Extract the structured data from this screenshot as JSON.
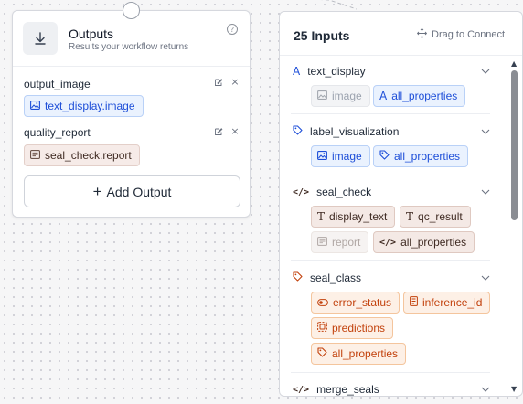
{
  "outputs_card": {
    "title": "Outputs",
    "subtitle": "Results your workflow returns",
    "help_glyph": "?",
    "outputs": [
      {
        "name": "output_image",
        "value": "text_display.image"
      },
      {
        "name": "quality_report",
        "value": "seal_check.report"
      }
    ],
    "add_label": "Add Output",
    "add_glyph": "+",
    "close_glyph": "×"
  },
  "inputs_panel": {
    "title": "25 Inputs",
    "drag_label": "Drag to Connect",
    "scroll_up_glyph": "▲",
    "scroll_down_glyph": "▼",
    "sections": [
      {
        "name": "text_display",
        "chips": [
          "image",
          "all_properties"
        ]
      },
      {
        "name": "label_visualization",
        "chips": [
          "image",
          "all_properties"
        ]
      },
      {
        "name": "seal_check",
        "chips": [
          "display_text",
          "qc_result",
          "report",
          "all_properties"
        ]
      },
      {
        "name": "seal_class",
        "chips": [
          "error_status",
          "inference_id",
          "predictions",
          "all_properties"
        ]
      },
      {
        "name": "merge_seals",
        "chips": []
      }
    ]
  },
  "colors": {
    "accent_blue": "#1d4ed8",
    "accent_orange": "#c2410c",
    "brown_text": "#3f2a22",
    "canvas": "#f6f6f7"
  },
  "icons": {
    "outputs": "arrow-down-to-line-icon",
    "help": "question-circle-icon",
    "edit": "pencil-square-icon",
    "close": "close-icon",
    "image": "image-icon",
    "text": "letter-a-icon",
    "tag": "tag-icon",
    "code": "code-brackets-icon",
    "move": "move-arrows-icon",
    "chevron": "chevron-down-icon"
  }
}
